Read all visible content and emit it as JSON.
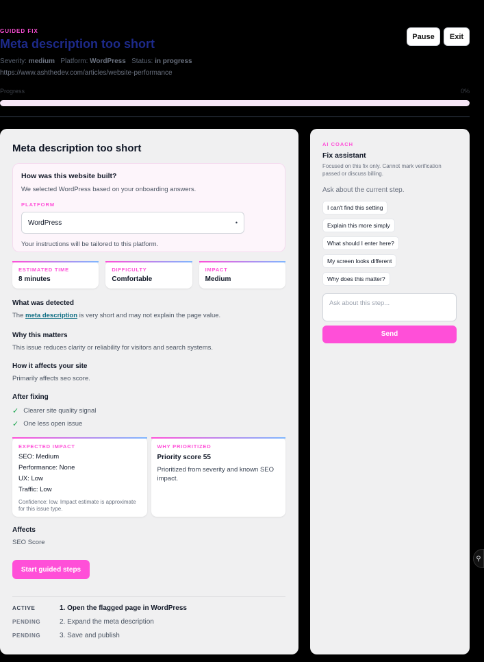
{
  "header": {
    "eyebrow": "GUIDED FIX",
    "title": "Meta description too short",
    "severity_label": "Severity:",
    "severity": "medium",
    "platform_label": "Platform:",
    "platform": "WordPress",
    "status_label": "Status:",
    "status": "in progress",
    "url": "https://www.ashthedev.com/articles/website-performance",
    "progress_label": "Progress",
    "progress_text": "0%",
    "progress_fraction": 0,
    "pause_label": "Pause",
    "exit_label": "Exit"
  },
  "main": {
    "title": "Meta description too short",
    "platform_card": {
      "question": "How was this website built?",
      "subtitle": "We selected WordPress based on your onboarding answers.",
      "field_label": "PLATFORM",
      "selected": "WordPress",
      "note": "Your instructions will be tailored to this platform."
    },
    "stats": [
      {
        "label": "ESTIMATED TIME",
        "value": "8 minutes"
      },
      {
        "label": "DIFFICULTY",
        "value": "Comfortable"
      },
      {
        "label": "IMPACT",
        "value": "Medium"
      }
    ],
    "detected": {
      "heading": "What was detected",
      "prefix": "The",
      "term": "meta description",
      "suffix": "is very short and may not explain the page value."
    },
    "why": {
      "heading": "Why this matters",
      "text": "This issue reduces clarity or reliability for visitors and search systems."
    },
    "affects_site": {
      "heading": "How it affects your site",
      "text": "Primarily affects seo score."
    },
    "after": {
      "heading": "After fixing",
      "items": [
        "Clearer site quality signal",
        "One less open issue"
      ]
    },
    "expected_impact": {
      "label": "EXPECTED IMPACT",
      "lines": [
        "SEO: Medium",
        "Performance: None",
        "UX: Low",
        "Traffic: Low"
      ],
      "confidence": "Confidence: low. Impact estimate is approximate for this issue type."
    },
    "why_prioritized": {
      "label": "WHY PRIORITIZED",
      "score": "Priority score 55",
      "text": "Prioritized from severity and known SEO impact."
    },
    "affects": {
      "heading": "Affects",
      "text": "SEO Score"
    },
    "start_button": "Start guided steps",
    "steps": [
      {
        "status": "ACTIVE",
        "text": "1. Open the flagged page in WordPress"
      },
      {
        "status": "PENDING",
        "text": "2. Expand the meta description"
      },
      {
        "status": "PENDING",
        "text": "3. Save and publish"
      }
    ]
  },
  "sidebar": {
    "eyebrow": "AI COACH",
    "title": "Fix assistant",
    "description": "Focused on this fix only. Cannot mark verification passed or discuss billing.",
    "ask": "Ask about the current step.",
    "chips": [
      "I can't find this setting",
      "Explain this more simply",
      "What should I enter here?",
      "My screen looks different",
      "Why does this matter?"
    ],
    "input_placeholder": "Ask about this step...",
    "send_label": "Send"
  },
  "icons": {
    "check": "check-icon",
    "caret": "chevron-down-icon",
    "edge_tab": "toggle-icon"
  },
  "colors": {
    "accent": "#ff4fd8",
    "title_blue": "#1d2a8a",
    "check_green": "#16a34a",
    "link": "#0f6e84"
  }
}
